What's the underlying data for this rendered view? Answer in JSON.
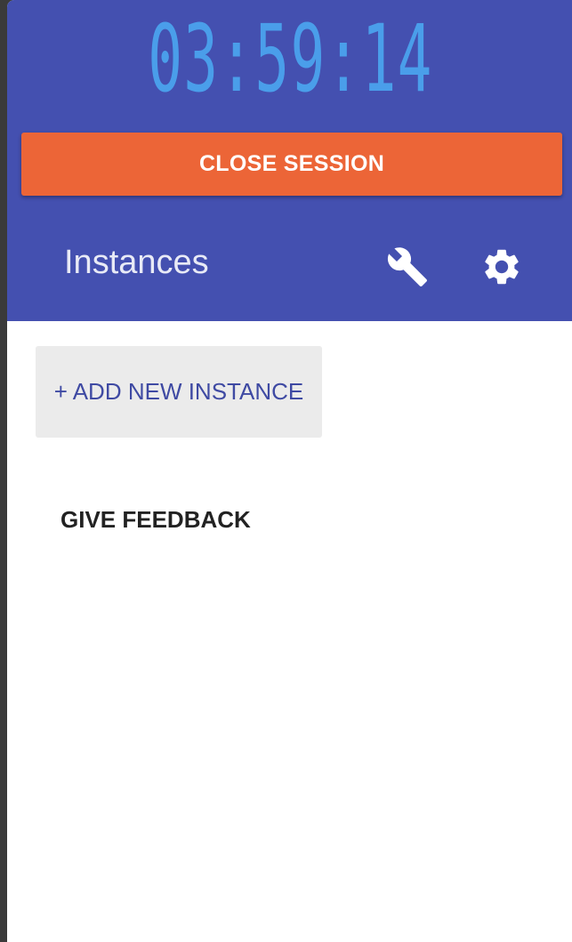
{
  "timer": {
    "value": "03:59:14"
  },
  "session": {
    "close_label": "CLOSE SESSION"
  },
  "instances": {
    "title": "Instances",
    "settings_icons": [
      "wrench-icon",
      "gear-icon"
    ],
    "add_label": "+ ADD NEW INSTANCE"
  },
  "feedback": {
    "label": "GIVE FEEDBACK"
  },
  "colors": {
    "header_bg": "#4450b0",
    "timer": "#4a9eea",
    "close_button": "#ec6537",
    "add_button_bg": "#ebebeb",
    "add_button_text": "#3f4aa3"
  }
}
